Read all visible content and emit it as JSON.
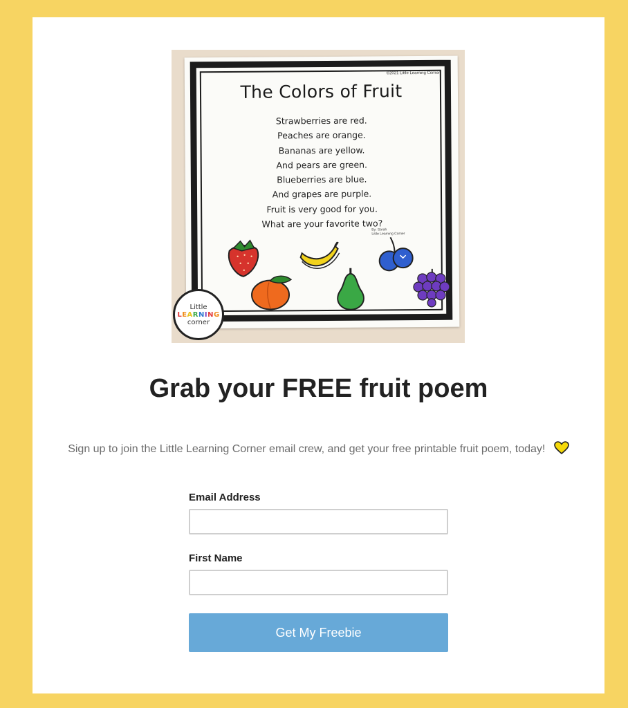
{
  "poem_image": {
    "copyright": "©2021 Little Learning Corner",
    "title": "The Colors of Fruit",
    "lines": [
      "Strawberries are red.",
      "Peaches are orange.",
      "Bananas are yellow.",
      "And pears are green.",
      "Blueberries are blue.",
      "And grapes are purple.",
      "Fruit is very good for you.",
      "What are your favorite two?"
    ],
    "byline_author": "By: Sarah",
    "byline_site": "Little Learning Corner",
    "logo_text": [
      "Little",
      "LEARNING",
      "corner"
    ]
  },
  "heading": "Grab your FREE fruit poem",
  "subtext": "Sign up to join the Little Learning Corner email crew, and get your free printable fruit poem, today!",
  "heart_icon": "yellow-heart-icon",
  "form": {
    "email_label": "Email Address",
    "email_value": "",
    "first_name_label": "First Name",
    "first_name_value": "",
    "submit_label": "Get My Freebie"
  },
  "colors": {
    "background": "#f7d462",
    "button": "#67a9d8",
    "heart": "#f5d90a"
  }
}
